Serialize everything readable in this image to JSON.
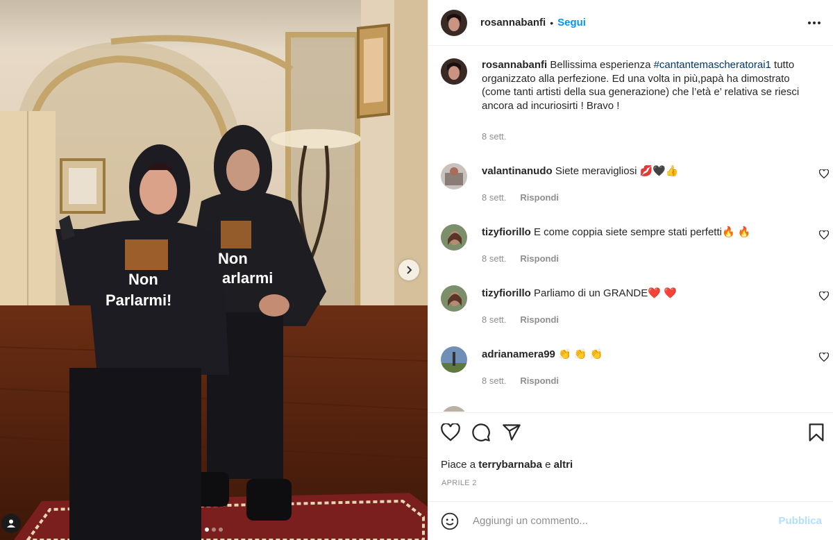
{
  "post": {
    "author": "rosannabanfi",
    "separator": "•",
    "follow_label": "Segui",
    "more_icon": "more-options-icon"
  },
  "caption": {
    "username": "rosannabanfi",
    "text_before": " Bellissima esperienza ",
    "hashtag": "#cantantemascheratorai1",
    "text_after": " tutto organizzato alla perfezione. Ed una volta in più,papà ha dimostrato (come tanti artisti della sua generazione) che l’età e’ relativa se riesci ancora ad incuriosirti ! Bravo !",
    "time": "8 sett."
  },
  "comments": [
    {
      "username": "valantinanudo",
      "text": " Siete meravigliosi 💋🖤👍",
      "time": "8 sett.",
      "reply_label": "Rispondi"
    },
    {
      "username": "tizyfiorillo",
      "text": " E come coppia siete sempre stati perfetti🔥 🔥",
      "time": "8 sett.",
      "reply_label": "Rispondi"
    },
    {
      "username": "tizyfiorillo",
      "text": " Parliamo di un GRANDE❤️ ❤️",
      "time": "8 sett.",
      "reply_label": "Rispondi"
    },
    {
      "username": "adrianamera99",
      "text": " 👏 👏 👏",
      "time": "8 sett.",
      "reply_label": "Rispondi"
    }
  ],
  "actions": {
    "like_icon": "heart-icon",
    "comment_icon": "comment-icon",
    "share_icon": "share-icon",
    "save_icon": "bookmark-icon"
  },
  "likes": {
    "prefix": "Piace a ",
    "user": "terrybarnaba",
    "middle": " e ",
    "others": "altri"
  },
  "post_date": "APRILE 2",
  "composer": {
    "placeholder": "Aggiungi un commento...",
    "publish_label": "Pubblica"
  },
  "carousel": {
    "slide_count": 3,
    "active_index": 0
  },
  "photo": {
    "hoodie_text_left": "Non Parlarmi!",
    "hoodie_text_right": "Non Parlarmi"
  },
  "colors": {
    "link_blue": "#0095f6",
    "hashtag": "#00376b",
    "muted": "#8e8e8e",
    "publish_disabled": "#b2dffc"
  }
}
